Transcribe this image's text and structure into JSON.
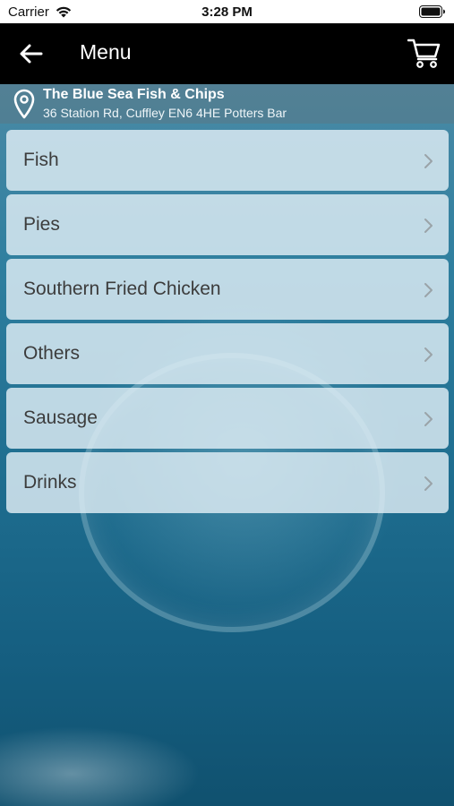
{
  "status_bar": {
    "carrier": "Carrier",
    "time": "3:28 PM"
  },
  "nav": {
    "title": "Menu",
    "back_icon": "arrow-left-icon",
    "cart_icon": "cart-icon"
  },
  "location": {
    "name": "The Blue Sea Fish & Chips",
    "address": "36 Station Rd, Cuffley EN6 4HE Potters Bar",
    "icon": "location-pin-icon"
  },
  "menu": {
    "items": [
      {
        "label": "Fish"
      },
      {
        "label": "Pies"
      },
      {
        "label": "Southern Fried Chicken"
      },
      {
        "label": "Others"
      },
      {
        "label": "Sausage"
      },
      {
        "label": "Drinks"
      }
    ]
  }
}
